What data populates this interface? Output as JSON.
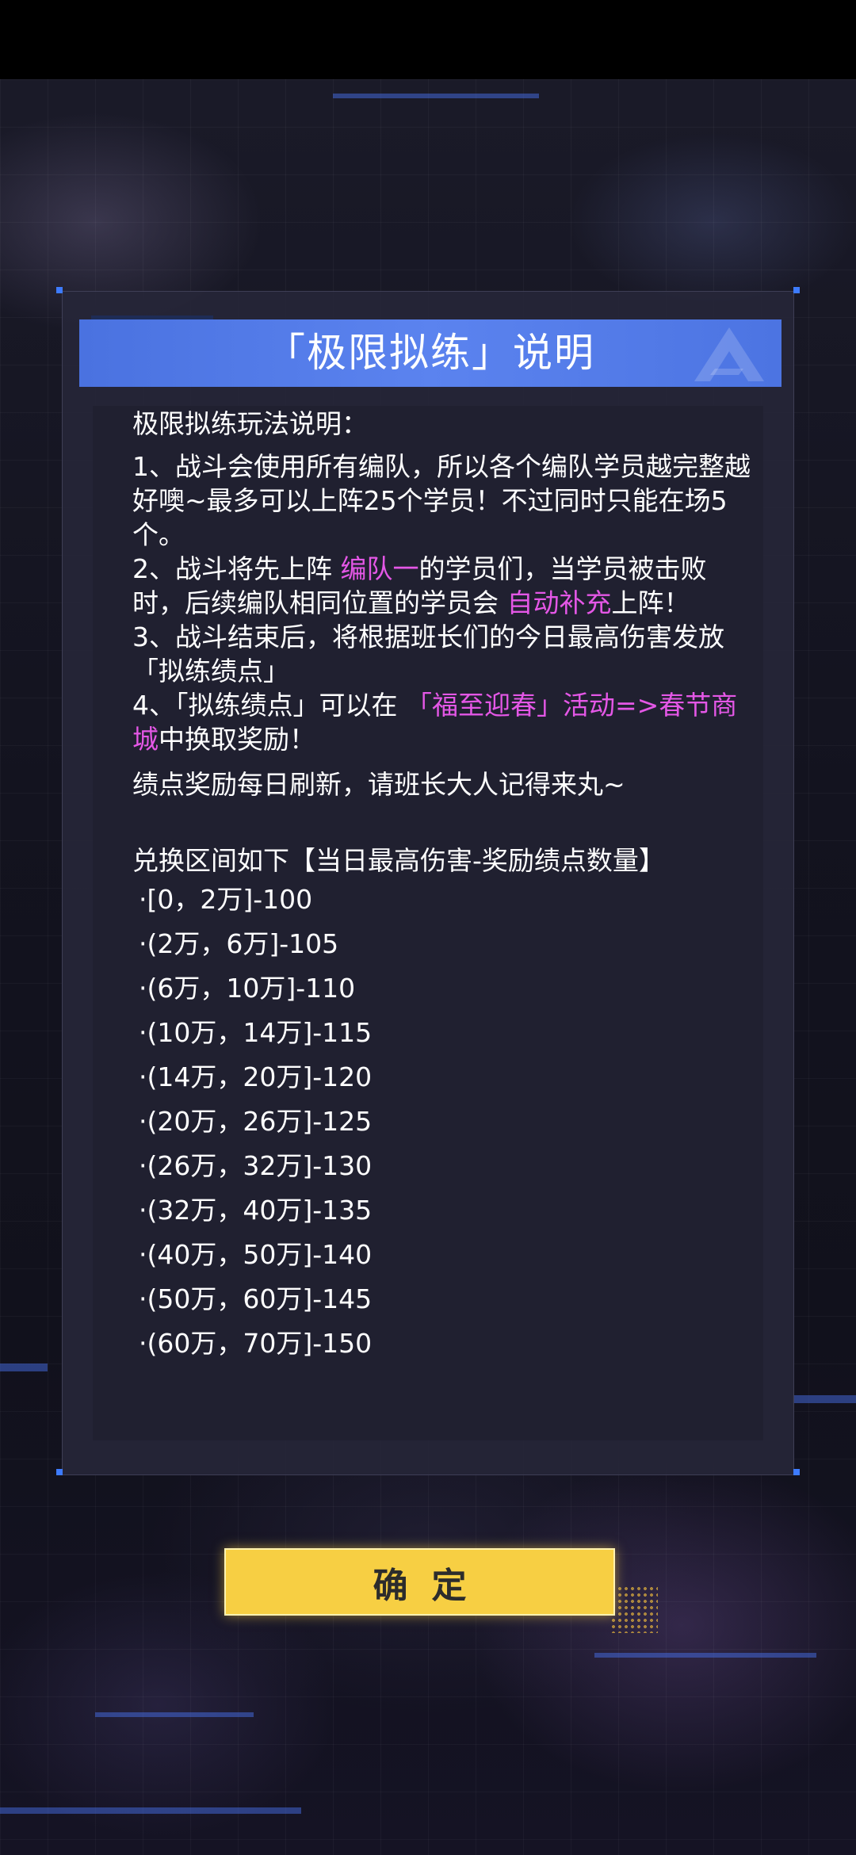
{
  "colors": {
    "accent_blue": "#4f77e6",
    "highlight": "#e457e6",
    "button_yellow": "#f7cf43",
    "panel": "#262638"
  },
  "dialog": {
    "title": "「极限拟练」说明",
    "intro": "极限拟练玩法说明：",
    "rule1": "1、战斗会使用所有编队，所以各个编队学员越完整越好噢~最多可以上阵25个学员！不过同时只能在场5个。",
    "rule2_a": "2、战斗将先上阵 ",
    "rule2_hl1": "编队一",
    "rule2_b": "的学员们，当学员被击败时，后续编队相同位置的学员会 ",
    "rule2_hl2": "自动补充",
    "rule2_c": "上阵！",
    "rule3": "3、战斗结束后，将根据班长们的今日最高伤害发放「拟练绩点」",
    "rule4_a": "4、「拟练绩点」可以在 ",
    "rule4_hl": "「福至迎春」活动=>春节商城",
    "rule4_b": "中换取奖励！",
    "refresh_note": "绩点奖励每日刷新，请班长大人记得来丸~",
    "exchange_header": "兑换区间如下【当日最高伤害-奖励绩点数量】",
    "ranges": [
      "·[0，2万]-100",
      "·(2万，6万]-105",
      "·(6万，10万]-110",
      "·(10万，14万]-115",
      "·(14万，20万]-120",
      "·(20万，26万]-125",
      "·(26万，32万]-130",
      "·(32万，40万]-135",
      "·(40万，50万]-140",
      "·(50万，60万]-145",
      "·(60万，70万]-150"
    ]
  },
  "confirm_button": {
    "label": "确定"
  }
}
